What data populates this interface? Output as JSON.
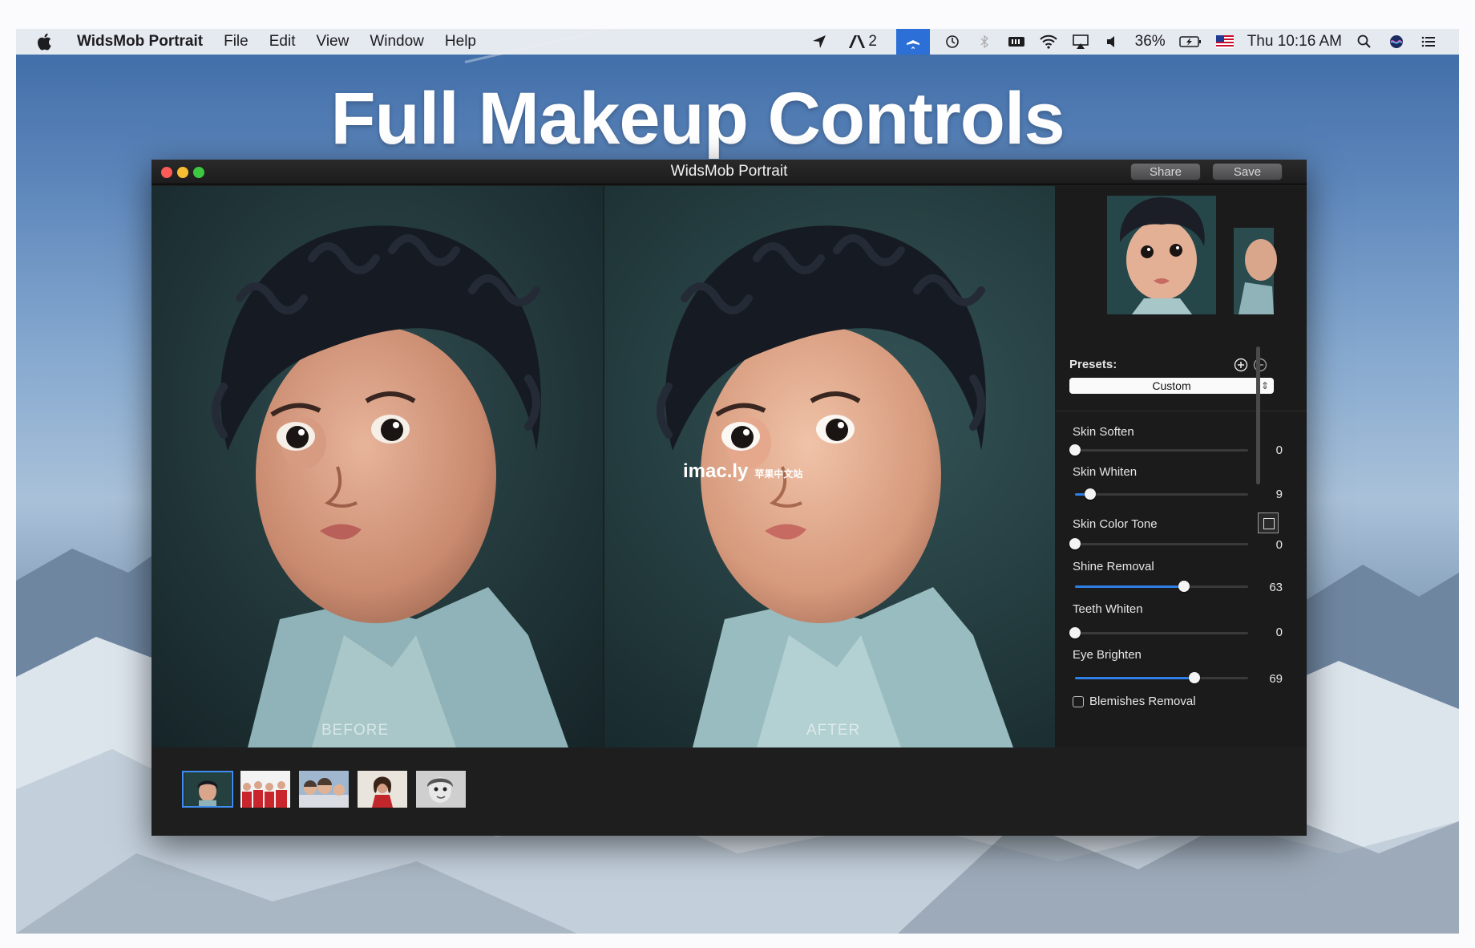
{
  "menubar": {
    "app_name": "WidsMob Portrait",
    "menus": [
      "File",
      "Edit",
      "View",
      "Window",
      "Help"
    ],
    "status": {
      "workspace_count": "2",
      "battery": "36%",
      "clock": "Thu 10:16 AM"
    }
  },
  "headline": "Full Makeup Controls",
  "window": {
    "title": "WidsMob Portrait",
    "share_label": "Share",
    "save_label": "Save"
  },
  "panes": {
    "before_label": "BEFORE",
    "after_label": "AFTER",
    "watermark_main": "imac.ly",
    "watermark_sub": "苹果中文站"
  },
  "presets": {
    "label": "Presets:",
    "selected": "Custom"
  },
  "controls": [
    {
      "label": "Skin Soften",
      "value": 0
    },
    {
      "label": "Skin Whiten",
      "value": 9
    },
    {
      "label": "Skin Color Tone",
      "value": 0
    },
    {
      "label": "Shine Removal",
      "value": 63
    },
    {
      "label": "Teeth Whiten",
      "value": 0
    },
    {
      "label": "Eye Brighten",
      "value": 69
    }
  ],
  "blemishes": {
    "label": "Blemishes Removal",
    "checked": false
  },
  "thumbnails": [
    "portrait-child",
    "group-red-shirts",
    "family-selfie",
    "woman-red-dress",
    "bw-child"
  ],
  "colors": {
    "accent": "#2f7fe6",
    "close": "#fc5b57",
    "minimize": "#f8be33",
    "zoom": "#3ec842"
  }
}
